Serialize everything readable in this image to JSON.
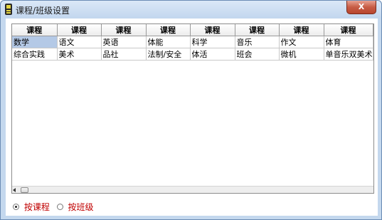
{
  "window": {
    "title": "课程/班级设置",
    "close_label": "X"
  },
  "grid": {
    "headers": [
      "课程",
      "课程",
      "课程",
      "课程",
      "课程",
      "课程",
      "课程",
      "课程"
    ],
    "rows": [
      [
        "数学",
        "语文",
        "英语",
        "体能",
        "科学",
        "音乐",
        "作文",
        "体育"
      ],
      [
        "综合实践",
        "美术",
        "品社",
        "法制/安全",
        "体活",
        "班会",
        "微机",
        "单音乐双美术"
      ]
    ],
    "selected_cell": "数学"
  },
  "options": {
    "by_course_label": "按课程",
    "by_class_label": "按班级",
    "selected": "按课程"
  },
  "colors": {
    "selection": "#b4c9e6",
    "radio_text": "#c00000",
    "close_button": "#c75c45"
  }
}
